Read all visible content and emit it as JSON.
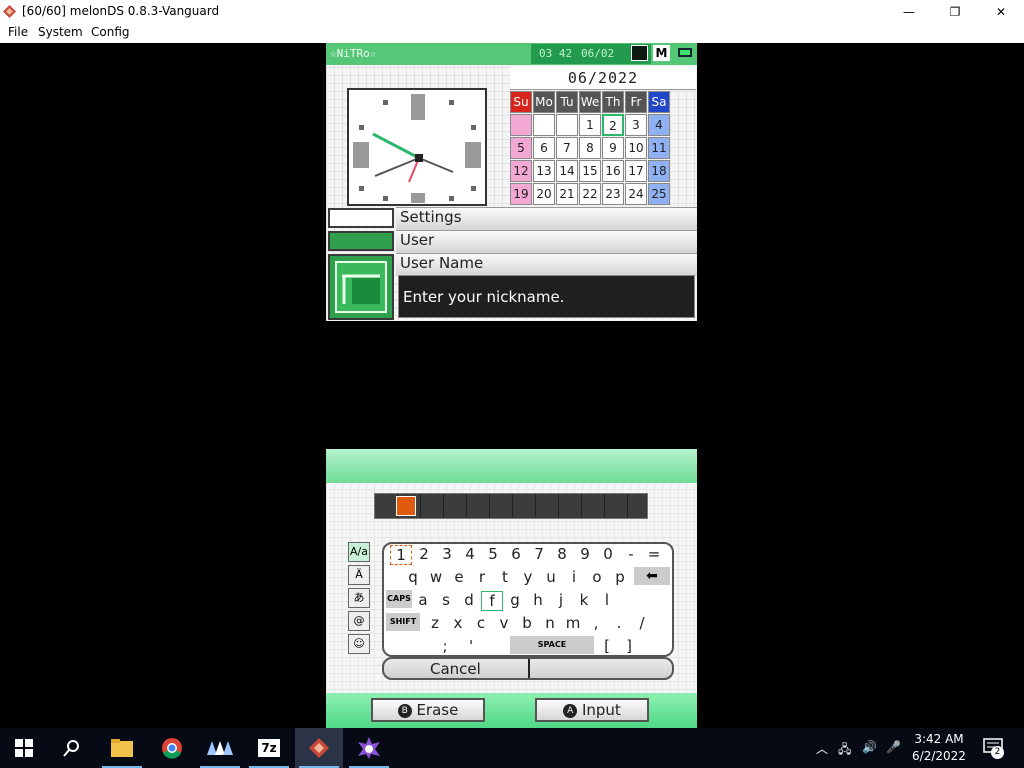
{
  "window": {
    "title": "[60/60] melonDS 0.8.3-Vanguard",
    "minimize_label": "—",
    "restore_label": "❐",
    "close_label": "✕"
  },
  "menu": [
    "File",
    "System",
    "Config"
  ],
  "top_screen": {
    "nickname": "☆NiTRo☆",
    "time": "03 42",
    "date": "06/02",
    "calendar": {
      "month_year": "06/2022",
      "weekdays": [
        "Su",
        "Mo",
        "Tu",
        "We",
        "Th",
        "Fr",
        "Sa"
      ],
      "weeks": [
        [
          "",
          "",
          "",
          "1",
          "2",
          "3",
          "4"
        ],
        [
          "5",
          "6",
          "7",
          "8",
          "9",
          "10",
          "11"
        ],
        [
          "12",
          "13",
          "14",
          "15",
          "16",
          "17",
          "18"
        ],
        [
          "19",
          "20",
          "21",
          "22",
          "23",
          "24",
          "25"
        ]
      ],
      "today": "2"
    },
    "menu_items": {
      "settings": "Settings",
      "user": "User",
      "user_name": "User Name"
    },
    "prompt": "Enter your nickname."
  },
  "keyboard": {
    "rows": [
      [
        "1",
        "2",
        "3",
        "4",
        "5",
        "6",
        "7",
        "8",
        "9",
        "0",
        "-",
        "="
      ],
      [
        "q",
        "w",
        "e",
        "r",
        "t",
        "y",
        "u",
        "i",
        "o",
        "p"
      ],
      [
        "a",
        "s",
        "d",
        "f",
        "g",
        "h",
        "j",
        "k",
        "l"
      ],
      [
        "z",
        "x",
        "c",
        "v",
        "b",
        "n",
        "m",
        ",",
        ".",
        "/"
      ],
      [
        ";",
        "'",
        "[",
        "]"
      ]
    ],
    "caps_label": "CAPS",
    "shift_label": "SHIFT",
    "space_label": "SPACE",
    "backspace_label": "⬅",
    "mode_tabs": [
      "A/a",
      "Ä",
      "あ",
      "@",
      "☺"
    ],
    "cancel_label": "Cancel"
  },
  "footer_buttons": {
    "erase": "Erase",
    "erase_badge": "B",
    "input": "Input",
    "input_badge": "A"
  },
  "taskbar": {
    "time": "3:42 AM",
    "date": "6/2/2022",
    "notification_count": "2",
    "apps": [
      "start-icon",
      "search-icon",
      "file-explorer-icon",
      "chrome-icon",
      "vanguard-icon",
      "7zip-icon",
      "melonds-icon",
      "app-icon"
    ]
  }
}
